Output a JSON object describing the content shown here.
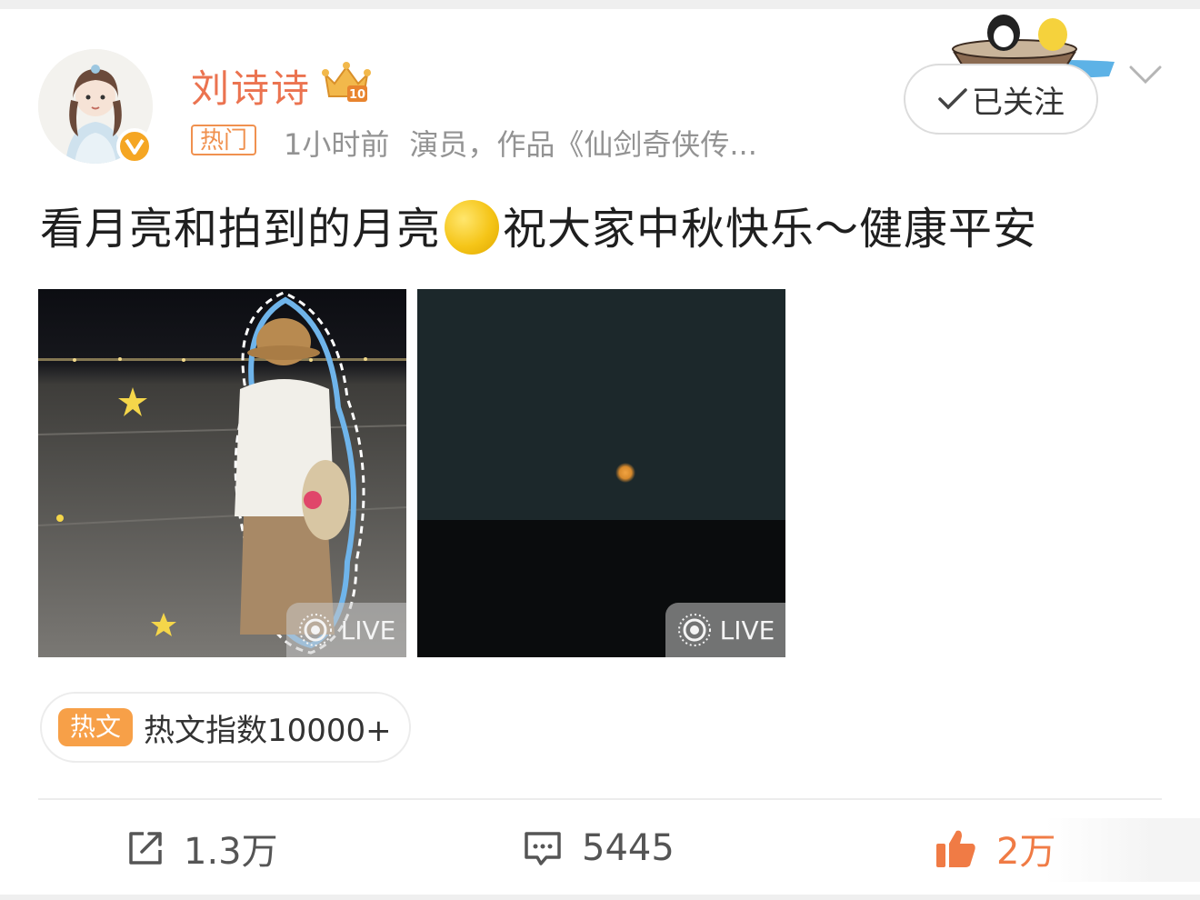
{
  "author": {
    "name": "刘诗诗",
    "level_badge": "10",
    "tag": "热门",
    "time": "1小时前",
    "description": "演员，作品《仙剑奇侠传..."
  },
  "follow": {
    "label": "已关注"
  },
  "post": {
    "text_before": "看月亮和拍到的月亮",
    "text_after": "祝大家中秋快乐～健康平安",
    "photos": [
      {
        "live_label": "LIVE"
      },
      {
        "live_label": "LIVE"
      }
    ]
  },
  "hot": {
    "icon_text": "热文",
    "label": "热文指数10000+"
  },
  "actions": {
    "repost_count": "1.3万",
    "comment_count": "5445",
    "like_count": "2万"
  },
  "colors": {
    "name": "#eb7350",
    "tag": "#f0914f",
    "like": "#f07b45",
    "hot_icon": "#f7a048"
  }
}
